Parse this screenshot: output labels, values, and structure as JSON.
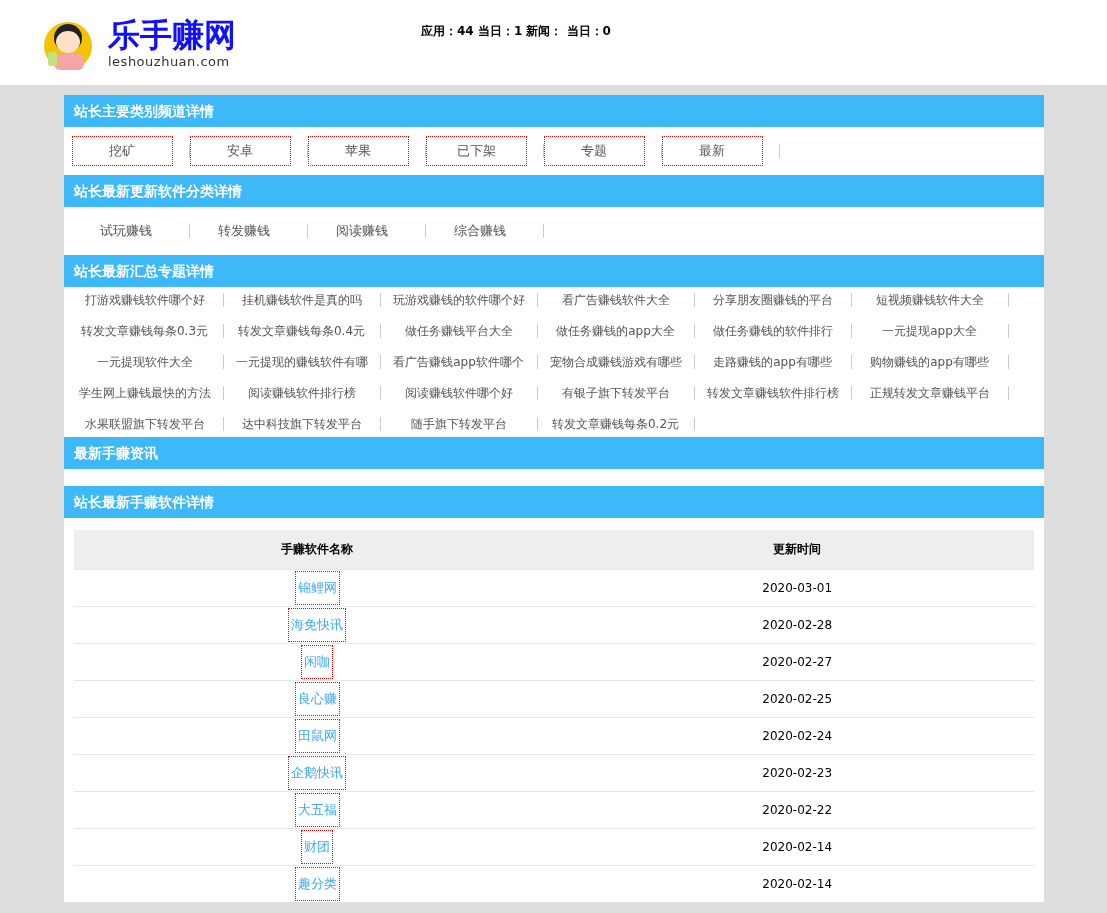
{
  "header": {
    "logo_title": "乐手赚网",
    "logo_domain": "leshouzhuan.com",
    "stats": "应用：44 当日：1 新闻： 当日：0"
  },
  "channels": {
    "title": "站长主要类别频道详情",
    "items": [
      "挖矿",
      "安卓",
      "苹果",
      "已下架",
      "专题",
      "最新"
    ]
  },
  "categories": {
    "title": "站长最新更新软件分类详情",
    "items": [
      "试玩赚钱",
      "转发赚钱",
      "阅读赚钱",
      "综合赚钱"
    ]
  },
  "topics": {
    "title": "站长最新汇总专题详情",
    "items": [
      "打游戏赚钱软件哪个好",
      "挂机赚钱软件是真的吗",
      "玩游戏赚钱的软件哪个好",
      "看广告赚钱软件大全",
      "分享朋友圈赚钱的平台",
      "短视频赚钱软件大全",
      "转发文章赚钱每条0.3元",
      "转发文章赚钱每条0.4元",
      "做任务赚钱平台大全",
      "做任务赚钱的app大全",
      "做任务赚钱的软件排行",
      "一元提现app大全",
      "一元提现软件大全",
      "一元提现的赚钱软件有哪",
      "看广告赚钱app软件哪个",
      "宠物合成赚钱游戏有哪些",
      "走路赚钱的app有哪些",
      "购物赚钱的app有哪些",
      "学生网上赚钱最快的方法",
      "阅读赚钱软件排行榜",
      "阅读赚钱软件哪个好",
      "有银子旗下转发平台",
      "转发文章赚钱软件排行榜",
      "正规转发文章赚钱平台",
      "水果联盟旗下转发平台",
      "达中科技旗下转发平台",
      "随手旗下转发平台",
      "转发文章赚钱每条0.2元"
    ]
  },
  "news": {
    "title": "最新手赚资讯"
  },
  "software": {
    "title": "站长最新手赚软件详情",
    "columns": [
      "手赚软件名称",
      "更新时间"
    ],
    "rows": [
      {
        "name": "锦鲤网",
        "date": "2020-03-01"
      },
      {
        "name": "海免快讯",
        "date": "2020-02-28"
      },
      {
        "name": "闲咖",
        "date": "2020-02-27"
      },
      {
        "name": "良心赚",
        "date": "2020-02-25"
      },
      {
        "name": "田鼠网",
        "date": "2020-02-24"
      },
      {
        "name": "企鹅快讯",
        "date": "2020-02-23"
      },
      {
        "name": "大五福",
        "date": "2020-02-22"
      },
      {
        "name": "财团",
        "date": "2020-02-14"
      },
      {
        "name": "趣分类",
        "date": "2020-02-14"
      }
    ]
  }
}
